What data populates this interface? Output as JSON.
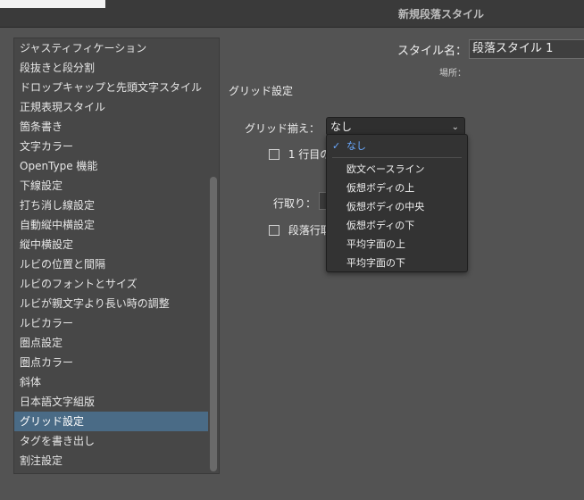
{
  "window": {
    "title": "新規段落スタイル"
  },
  "sidebar": {
    "items": [
      {
        "label": "ジャスティフィケーション"
      },
      {
        "label": "段抜きと段分割"
      },
      {
        "label": "ドロップキャップと先頭文字スタイル"
      },
      {
        "label": "正規表現スタイル"
      },
      {
        "label": "箇条書き"
      },
      {
        "label": "文字カラー"
      },
      {
        "label": "OpenType 機能"
      },
      {
        "label": "下線設定"
      },
      {
        "label": "打ち消し線設定"
      },
      {
        "label": "自動縦中横設定"
      },
      {
        "label": "縦中横設定"
      },
      {
        "label": "ルビの位置と間隔"
      },
      {
        "label": "ルビのフォントとサイズ"
      },
      {
        "label": "ルビが親文字より長い時の調整"
      },
      {
        "label": "ルビカラー"
      },
      {
        "label": "圏点設定"
      },
      {
        "label": "圏点カラー"
      },
      {
        "label": "斜体"
      },
      {
        "label": "日本語文字組版"
      },
      {
        "label": "グリッド設定"
      },
      {
        "label": "タグを書き出し"
      },
      {
        "label": "割注設定"
      }
    ],
    "selected_label": "グリッド設定"
  },
  "header": {
    "style_name_label": "スタイル名：",
    "style_name_value": "段落スタイル 1",
    "location_label": "場所："
  },
  "grid": {
    "section_title": "グリッド設定",
    "align_label": "グリッド揃え：",
    "align_value": "なし",
    "first_line_label": "1 行目の",
    "leading_label": "行取り：",
    "para_line_label": "段落行取"
  },
  "dropdown": {
    "options": [
      {
        "label": "なし",
        "checked": true
      },
      {
        "label": "欧文ベースライン"
      },
      {
        "label": "仮想ボディの上"
      },
      {
        "label": "仮想ボディの中央"
      },
      {
        "label": "仮想ボディの下"
      },
      {
        "label": "平均字面の上"
      },
      {
        "label": "平均字面の下"
      }
    ]
  },
  "colors": {
    "background": "#535353",
    "selected": "#4a6b86",
    "accent": "#6aa9ff"
  }
}
